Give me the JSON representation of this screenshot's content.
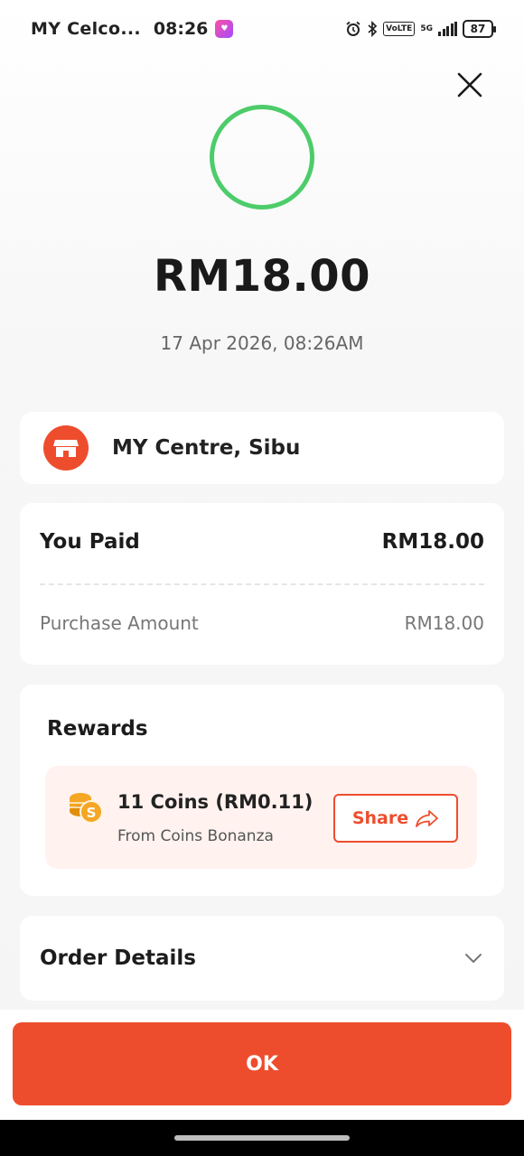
{
  "status_bar": {
    "carrier": "MY Celco...",
    "time": "08:26",
    "volte": "VoLTE",
    "network": "5G",
    "battery": "87"
  },
  "payment": {
    "amount": "RM18.00",
    "datetime": "17 Apr 2026, 08:26AM",
    "status_color": "#4dcc6a"
  },
  "merchant": {
    "name": "MY Centre, Sibu",
    "icon": "shop-icon"
  },
  "summary": {
    "you_paid_label": "You Paid",
    "you_paid_value": "RM18.00",
    "purchase_label": "Purchase Amount",
    "purchase_value": "RM18.00"
  },
  "rewards": {
    "title": "Rewards",
    "coins_text": "11 Coins (RM0.11)",
    "source_text": "From Coins Bonanza",
    "share_label": "Share",
    "icon": "coin-icon"
  },
  "order_details": {
    "label": "Order Details"
  },
  "actions": {
    "ok_label": "OK"
  },
  "colors": {
    "accent": "#ee4d2d",
    "success": "#4dcc6a",
    "coin": "#f5a623"
  }
}
